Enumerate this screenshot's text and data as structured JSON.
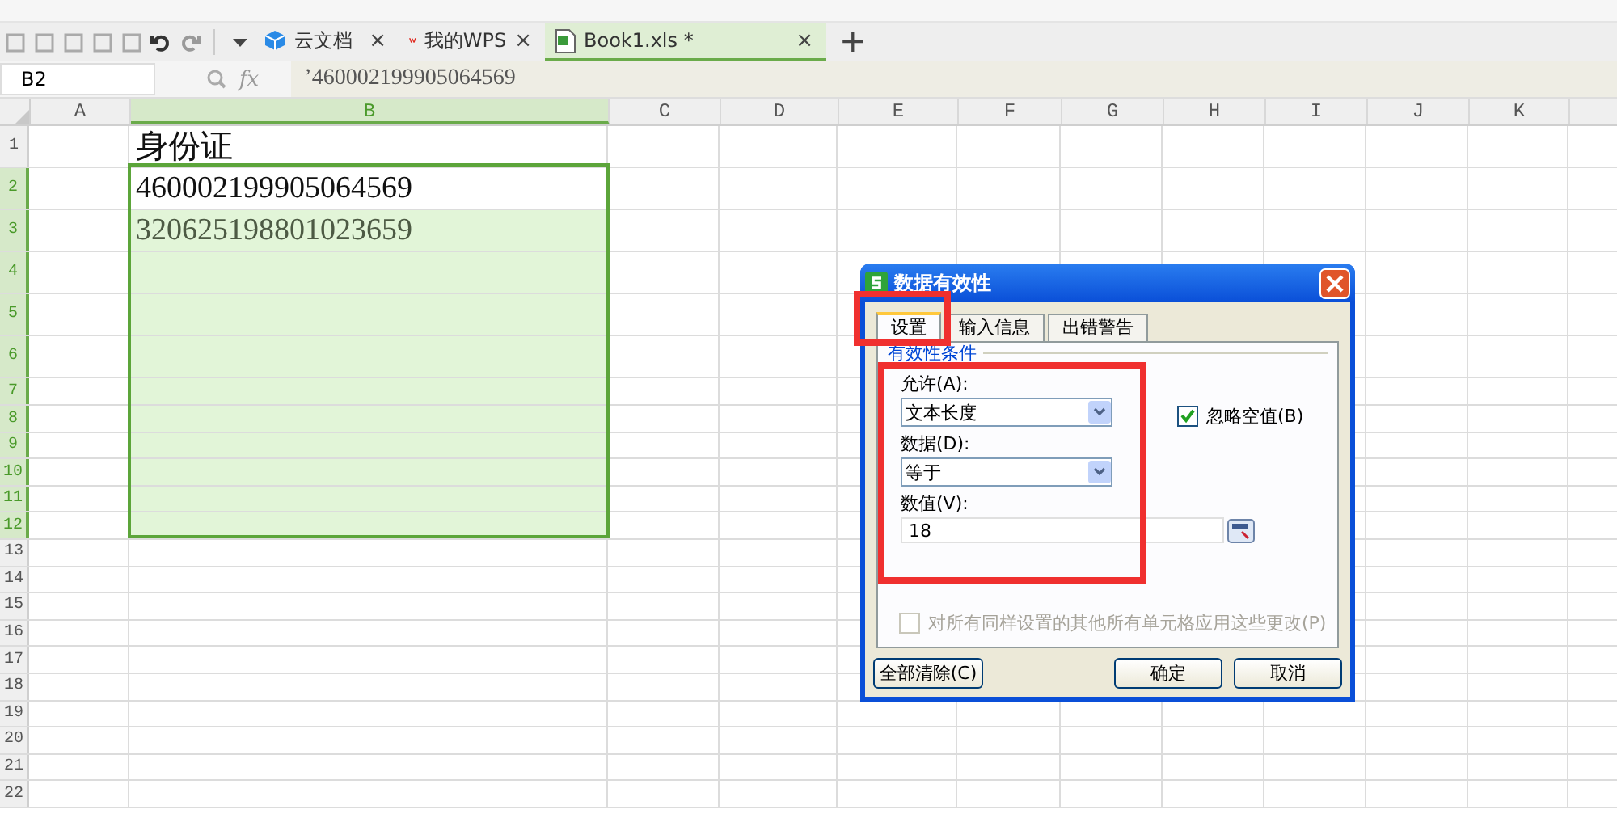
{
  "doc_tabs": [
    {
      "label": "云文档",
      "kind": "cloud",
      "selected": false,
      "close": "×"
    },
    {
      "label": "我的WPS",
      "kind": "wps",
      "selected": false,
      "close": "×"
    },
    {
      "label": "Book1.xls *",
      "kind": "sheet",
      "selected": true,
      "close": "×"
    }
  ],
  "new_tab": "+",
  "formula_bar": {
    "name_box": "B2",
    "fx": "fx",
    "value": "’460002199905064569"
  },
  "columns": [
    {
      "label": "A",
      "selected": false
    },
    {
      "label": "B",
      "selected": true
    },
    {
      "label": "C",
      "selected": false
    },
    {
      "label": "D",
      "selected": false
    },
    {
      "label": "E",
      "selected": false
    },
    {
      "label": "F",
      "selected": false
    },
    {
      "label": "G",
      "selected": false
    },
    {
      "label": "H",
      "selected": false
    },
    {
      "label": "I",
      "selected": false
    },
    {
      "label": "J",
      "selected": false
    },
    {
      "label": "K",
      "selected": false
    }
  ],
  "rows": [
    {
      "label": "1",
      "selected": false,
      "b": {
        "text": "身份证",
        "selected": false
      }
    },
    {
      "label": "2",
      "selected": true,
      "b": {
        "text": "460002199905064569",
        "selected": true,
        "active": true
      }
    },
    {
      "label": "3",
      "selected": true,
      "b": {
        "text": "320625198801023659",
        "selected": true
      }
    },
    {
      "label": "4",
      "selected": true,
      "b": {
        "selected": true
      }
    },
    {
      "label": "5",
      "selected": true,
      "b": {
        "selected": true
      }
    },
    {
      "label": "6",
      "selected": true,
      "b": {
        "selected": true
      }
    },
    {
      "label": "7",
      "selected": true,
      "b": {
        "selected": true
      }
    },
    {
      "label": "8",
      "selected": true,
      "b": {
        "selected": true
      }
    },
    {
      "label": "9",
      "selected": true,
      "b": {
        "selected": true
      }
    },
    {
      "label": "10",
      "selected": true,
      "b": {
        "selected": true
      }
    },
    {
      "label": "11",
      "selected": true,
      "b": {
        "selected": true
      }
    },
    {
      "label": "12",
      "selected": true,
      "b": {
        "selected": true
      }
    },
    {
      "label": "13",
      "selected": false,
      "b": {
        "selected": false
      }
    },
    {
      "label": "14",
      "selected": false,
      "b": {
        "selected": false
      }
    },
    {
      "label": "15",
      "selected": false,
      "b": {
        "selected": false
      }
    },
    {
      "label": "16",
      "selected": false,
      "b": {
        "selected": false
      }
    },
    {
      "label": "17",
      "selected": false,
      "b": {
        "selected": false
      }
    },
    {
      "label": "18",
      "selected": false,
      "b": {
        "selected": false
      }
    },
    {
      "label": "19",
      "selected": false,
      "b": {
        "selected": false
      }
    },
    {
      "label": "20",
      "selected": false,
      "b": {
        "selected": false
      }
    },
    {
      "label": "21",
      "selected": false,
      "b": {
        "selected": false
      }
    },
    {
      "label": "22",
      "selected": false,
      "b": {
        "selected": false
      }
    }
  ],
  "dialog": {
    "title": "数据有效性",
    "tabs": [
      {
        "label": "设置",
        "selected": true
      },
      {
        "label": "输入信息",
        "selected": false
      },
      {
        "label": "出错警告",
        "selected": false
      }
    ],
    "group_label": "有效性条件",
    "allow_label": "允许(A):",
    "allow_value": "文本长度",
    "ignore_blank": {
      "label": "忽略空值(B)",
      "checked": true
    },
    "data_label": "数据(D):",
    "data_value": "等于",
    "value_label": "数值(V):",
    "value": "18",
    "apply_all": {
      "label": "对所有同样设置的其他所有单元格应用这些更改(P)",
      "checked": false,
      "disabled": true
    },
    "buttons": [
      {
        "label": "全部清除(C)"
      },
      {
        "label": "确定"
      },
      {
        "label": "取消"
      }
    ]
  }
}
